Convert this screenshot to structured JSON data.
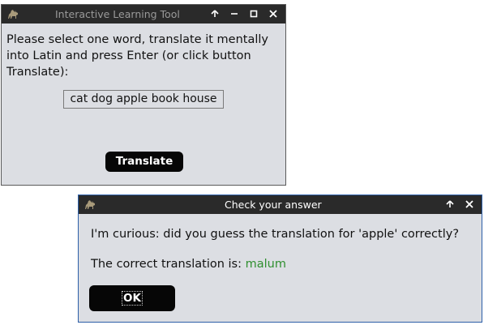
{
  "main_window": {
    "title": "Interactive Learning Tool",
    "prompt": "Please select one word, translate it mentally into Latin and press Enter (or click button Translate):",
    "words": "cat dog apple book house",
    "translate_button": "Translate",
    "titlebar_buttons": [
      "keep-above",
      "minimize",
      "maximize",
      "close"
    ]
  },
  "dialog": {
    "title": "Check your answer",
    "question": "I'm curious: did you guess the translation for 'apple' correctly?",
    "answer_label": "The correct translation is: ",
    "answer_value": "malum",
    "ok_button": "OK",
    "titlebar_buttons": [
      "keep-above",
      "close"
    ]
  },
  "colors": {
    "titlebar": "#2a2a2a",
    "window_bg": "#dcdee3",
    "button_bg": "#060606",
    "answer_green": "#2f8f2f",
    "dialog_border": "#2d5fa8"
  }
}
